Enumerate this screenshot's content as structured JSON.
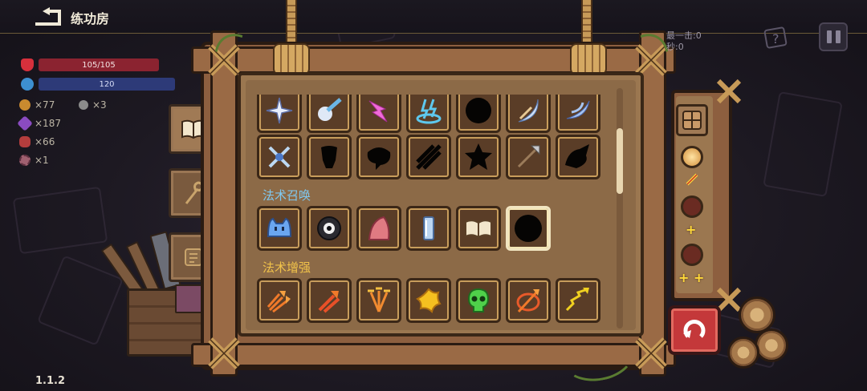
{
  "header": {
    "title": "练功房"
  },
  "stats": {
    "hp_label": "105/105",
    "mp_label": "120",
    "resources": [
      {
        "name": "coin",
        "value": "×77",
        "color": "#c98a2f"
      },
      {
        "name": "key",
        "value": "×3",
        "color": "#8b8b8b"
      },
      {
        "name": "gem",
        "value": "×187",
        "color": "#8a4bc0"
      },
      {
        "name": "meat",
        "value": "×66",
        "color": "#b43d3d"
      },
      {
        "name": "gear",
        "value": "×1",
        "color": "#a06070"
      }
    ]
  },
  "tabs": [
    {
      "name": "spellbook",
      "icon": "book-icon"
    },
    {
      "name": "staff",
      "icon": "staff-icon"
    },
    {
      "name": "scroll",
      "icon": "scroll-icon"
    }
  ],
  "sections": {
    "summon": "法术召唤",
    "enhance": "法术增强"
  },
  "damage": {
    "line1": "最一击:0",
    "line2": "秒:0"
  },
  "colors": {
    "summon_label": "#7fc8f0",
    "enhance_label": "#f0c24a",
    "frame": "#8d5f3f",
    "reset": "#c4383a"
  },
  "version": "1.1.2"
}
